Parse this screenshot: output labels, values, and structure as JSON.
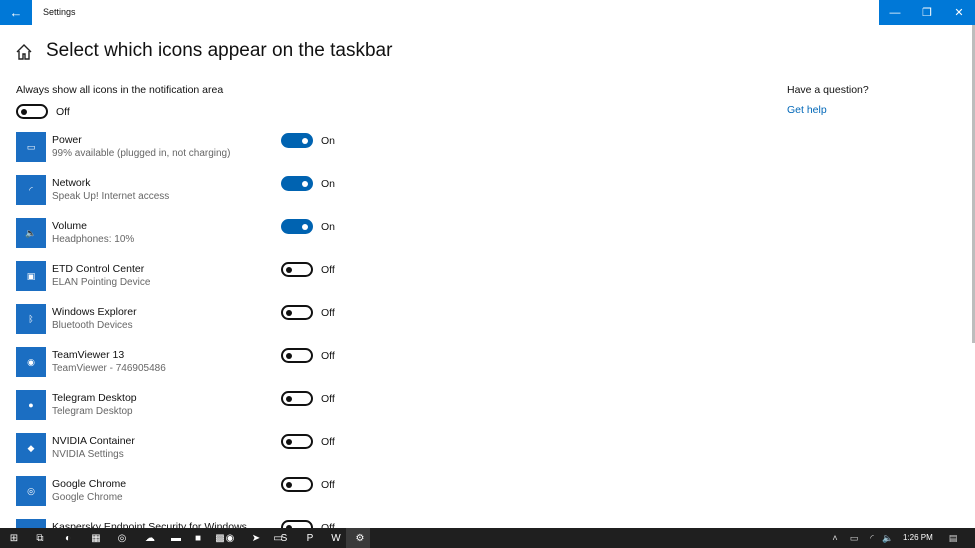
{
  "window": {
    "title": "Settings",
    "back_glyph": "←",
    "minimize_glyph": "—",
    "restore_glyph": "❐",
    "close_glyph": "✕"
  },
  "header": {
    "title": "Select which icons appear on the taskbar"
  },
  "always_show": {
    "label": "Always show all icons in the notification area",
    "state": "Off"
  },
  "items": [
    {
      "name": "Power",
      "sub": "99% available (plugged in, not charging)",
      "state": "On",
      "icon_glyph": "▭",
      "icon": "battery-icon",
      "icon_color": "#1b6ec2"
    },
    {
      "name": "Network",
      "sub": "Speak Up! Internet access",
      "state": "On",
      "icon_glyph": "◜",
      "icon": "wifi-icon",
      "icon_color": "#1b6ec2"
    },
    {
      "name": "Volume",
      "sub": "Headphones: 10%",
      "state": "On",
      "icon_glyph": "🔈",
      "icon": "speaker-icon",
      "icon_color": "#1b6ec2"
    },
    {
      "name": "ETD Control Center",
      "sub": "ELAN Pointing Device",
      "state": "Off",
      "icon_glyph": "▣",
      "icon": "touchpad-icon",
      "icon_color": "#1b6ec2"
    },
    {
      "name": "Windows Explorer",
      "sub": "Bluetooth Devices",
      "state": "Off",
      "icon_glyph": "ᛒ",
      "icon": "bluetooth-icon",
      "icon_color": "#1b6ec2"
    },
    {
      "name": "TeamViewer 13",
      "sub": "TeamViewer - 746905486",
      "state": "Off",
      "icon_glyph": "◉",
      "icon": "teamviewer-icon",
      "icon_color": "#1b6ec2"
    },
    {
      "name": "Telegram Desktop",
      "sub": "Telegram Desktop",
      "state": "Off",
      "icon_glyph": "●",
      "icon": "telegram-icon",
      "icon_color": "#1b6ec2"
    },
    {
      "name": "NVIDIA Container",
      "sub": "NVIDIA Settings",
      "state": "Off",
      "icon_glyph": "◆",
      "icon": "nvidia-icon",
      "icon_color": "#1b6ec2"
    },
    {
      "name": "Google Chrome",
      "sub": "Google Chrome",
      "state": "Off",
      "icon_glyph": "◎",
      "icon": "chrome-icon",
      "icon_color": "#1b6ec2"
    },
    {
      "name": "Kaspersky Endpoint Security for Windows",
      "sub": "",
      "state": "Off",
      "icon_glyph": "▤",
      "icon": "kaspersky-icon",
      "icon_color": "#1b6ec2"
    }
  ],
  "sidebar": {
    "question": "Have a question?",
    "help_link": "Get help"
  },
  "taskbar": {
    "clock": "1:26 PM",
    "apps": [
      {
        "icon": "start-icon",
        "glyph": "⊞"
      },
      {
        "icon": "task-view-icon",
        "glyph": "⧉"
      },
      {
        "icon": "app-icon",
        "glyph": "◐"
      },
      {
        "icon": "calculator-icon",
        "glyph": "▦"
      },
      {
        "icon": "media-icon",
        "glyph": "◎"
      },
      {
        "icon": "cloud-icon",
        "glyph": "☁"
      },
      {
        "icon": "file-explorer-icon",
        "glyph": "▬"
      },
      {
        "icon": "sticky-notes-icon",
        "glyph": "■"
      },
      {
        "icon": "photo-icon",
        "glyph": "▩"
      },
      {
        "icon": "chrome-icon",
        "glyph": "◉"
      },
      {
        "icon": "telegram-icon",
        "glyph": "➤"
      },
      {
        "icon": "folder-icon",
        "glyph": "▭"
      },
      {
        "icon": "skype-icon",
        "glyph": "S"
      },
      {
        "icon": "photoshop-icon",
        "glyph": "P"
      },
      {
        "icon": "word-icon",
        "glyph": "W"
      },
      {
        "icon": "settings-icon",
        "glyph": "⚙"
      }
    ],
    "tray": [
      {
        "icon": "chevron-up-icon",
        "glyph": "˄"
      },
      {
        "icon": "battery-icon",
        "glyph": "▭"
      },
      {
        "icon": "wifi-icon",
        "glyph": "◜"
      },
      {
        "icon": "speaker-icon",
        "glyph": "🔈"
      },
      {
        "icon": "notification-icon",
        "glyph": "▤"
      }
    ]
  }
}
